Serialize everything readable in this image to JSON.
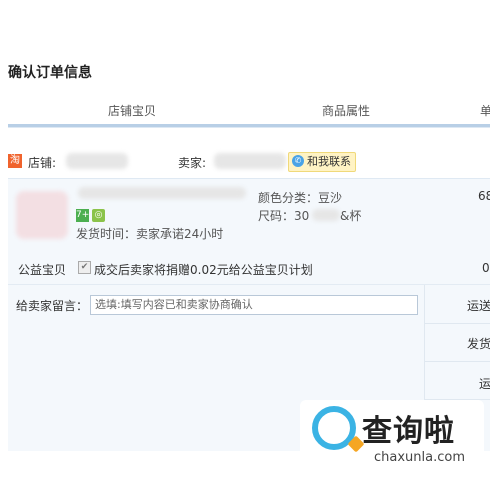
{
  "page": {
    "title": "确认订单信息"
  },
  "header": {
    "col_shop_item": "店铺宝贝",
    "col_attr": "商品属性",
    "col_price": "单"
  },
  "shop": {
    "shop_label": "店铺:",
    "seller_label": "卖家:",
    "contact_label": "和我联系",
    "logo_text": "淘"
  },
  "item": {
    "attr_color": "颜色分类：豆沙",
    "attr_size": "尺码：30",
    "attr_size_suffix": "&杯",
    "shipping": "发货时间：卖家承诺24小时",
    "price": "68",
    "badge_1": "7+",
    "badge_2": "◎"
  },
  "charity": {
    "label": "公益宝贝",
    "text": "成交后卖家将捐赠0.02元给公益宝贝计划",
    "value": "0"
  },
  "note": {
    "label": "给卖家留言：",
    "placeholder": "选填:填写内容已和卖家协商确认"
  },
  "right_col": {
    "ship_method": "运送",
    "invoice": "发货",
    "freight": "运"
  },
  "watermark": {
    "name": "查询啦",
    "url": "chaxunla.com"
  }
}
